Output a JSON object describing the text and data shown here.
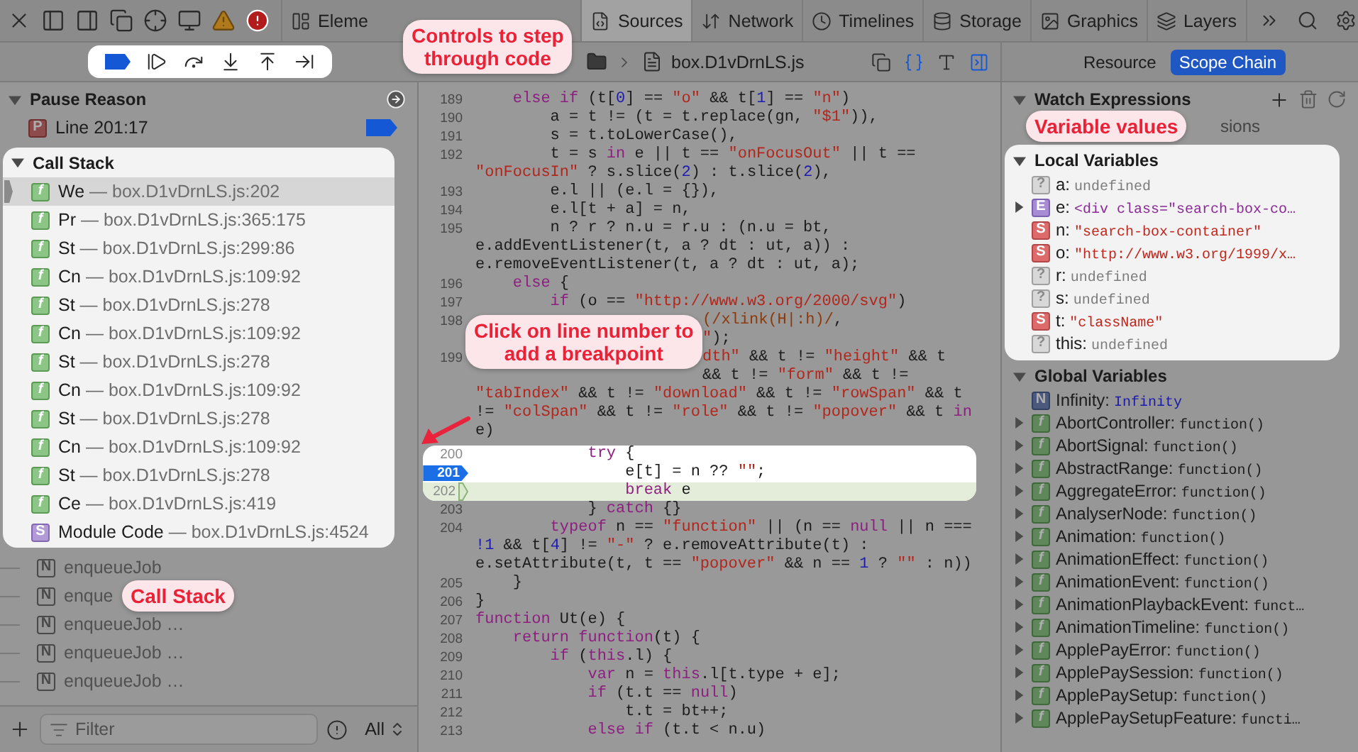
{
  "toolbar": {
    "tabs": [
      {
        "kind": "elements",
        "label": "Eleme",
        "selected": false
      },
      {
        "kind": "sources",
        "label": "Sources",
        "selected": true
      },
      {
        "kind": "network",
        "label": "Network",
        "selected": false
      },
      {
        "kind": "timelines",
        "label": "Timelines",
        "selected": false
      },
      {
        "kind": "storage",
        "label": "Storage",
        "selected": false
      },
      {
        "kind": "graphics",
        "label": "Graphics",
        "selected": false
      },
      {
        "kind": "layers",
        "label": "Layers",
        "selected": false
      }
    ]
  },
  "debugger_bar": {
    "highlighted": true
  },
  "navigation": {
    "file": "box.D1vDrnLS.js"
  },
  "sidebar_switch": [
    {
      "label": "Resource",
      "selected": false
    },
    {
      "label": "Scope Chain",
      "selected": true
    }
  ],
  "pause_reason": {
    "title": "Pause Reason",
    "expanded": true,
    "kind": "pause",
    "badge": "P",
    "text": "Line 201:17"
  },
  "call_stack": {
    "title": "Call Stack",
    "expanded": true,
    "highlighted": true,
    "frames": [
      {
        "kind": "function",
        "badge": "f",
        "name": "We",
        "location": "— box.D1vDrnLS.js:202",
        "selected": true
      },
      {
        "kind": "function",
        "badge": "f",
        "name": "Pr",
        "location": "— box.D1vDrnLS.js:365:175",
        "selected": false
      },
      {
        "kind": "function",
        "badge": "f",
        "name": "St",
        "location": "— box.D1vDrnLS.js:299:86",
        "selected": false
      },
      {
        "kind": "function",
        "badge": "f",
        "name": "Cn",
        "location": "— box.D1vDrnLS.js:109:92",
        "selected": false
      },
      {
        "kind": "function",
        "badge": "f",
        "name": "St",
        "location": "— box.D1vDrnLS.js:278",
        "selected": false
      },
      {
        "kind": "function",
        "badge": "f",
        "name": "Cn",
        "location": "— box.D1vDrnLS.js:109:92",
        "selected": false
      },
      {
        "kind": "function",
        "badge": "f",
        "name": "St",
        "location": "— box.D1vDrnLS.js:278",
        "selected": false
      },
      {
        "kind": "function",
        "badge": "f",
        "name": "Cn",
        "location": "— box.D1vDrnLS.js:109:92",
        "selected": false
      },
      {
        "kind": "function",
        "badge": "f",
        "name": "St",
        "location": "— box.D1vDrnLS.js:278",
        "selected": false
      },
      {
        "kind": "function",
        "badge": "f",
        "name": "Cn",
        "location": "— box.D1vDrnLS.js:109:92",
        "selected": false
      },
      {
        "kind": "function",
        "badge": "f",
        "name": "St",
        "location": "— box.D1vDrnLS.js:278",
        "selected": false
      },
      {
        "kind": "function",
        "badge": "f",
        "name": "Ce",
        "location": "— box.D1vDrnLS.js:419",
        "selected": false
      },
      {
        "kind": "script",
        "badge": "S",
        "name": "Module Code",
        "location": "— box.D1vDrnLS.js:4524",
        "selected": false
      }
    ]
  },
  "async_frames": [
    {
      "kind": "native",
      "badge": "N",
      "name": "enqueueJob"
    },
    {
      "kind": "native",
      "badge": "N",
      "name": "enque"
    },
    {
      "kind": "native",
      "badge": "N",
      "name": "enqueueJob …"
    },
    {
      "kind": "native",
      "badge": "N",
      "name": "enqueueJob …"
    },
    {
      "kind": "native",
      "badge": "N",
      "name": "enqueueJob …"
    }
  ],
  "filter": {
    "placeholder": "Filter",
    "scope": "All"
  },
  "code": {
    "blocks": [
      {
        "highlighted": false,
        "rows": [
          {
            "number": "189",
            "kind": "plain",
            "tokens": [
              {
                "kind": "keyword",
                "text": "    else if"
              },
              {
                "kind": "plain",
                "text": " (t["
              },
              {
                "kind": "number",
                "text": "0"
              },
              {
                "kind": "plain",
                "text": "] == "
              },
              {
                "kind": "string",
                "text": "\"o\""
              },
              {
                "kind": "plain",
                "text": " && t["
              },
              {
                "kind": "number",
                "text": "1"
              },
              {
                "kind": "plain",
                "text": "] == "
              },
              {
                "kind": "string",
                "text": "\"n\""
              },
              {
                "kind": "plain",
                "text": ")"
              }
            ]
          },
          {
            "number": "190",
            "kind": "plain",
            "tokens": [
              {
                "kind": "plain",
                "text": "        a = t != (t = t.replace(gn, "
              },
              {
                "kind": "string",
                "text": "\"$1\""
              },
              {
                "kind": "plain",
                "text": ")),"
              }
            ]
          },
          {
            "number": "191",
            "kind": "plain",
            "tokens": [
              {
                "kind": "plain",
                "text": "        s = t.toLowerCase(),"
              }
            ]
          },
          {
            "number": "192",
            "kind": "plain",
            "tokens": [
              {
                "kind": "plain",
                "text": "        t = s "
              },
              {
                "kind": "keyword",
                "text": "in"
              },
              {
                "kind": "plain",
                "text": " e || t == "
              },
              {
                "kind": "string",
                "text": "\"onFocusOut\""
              },
              {
                "kind": "plain",
                "text": " || t =="
              }
            ]
          },
          {
            "kind": "plain",
            "tokens": [
              {
                "kind": "string",
                "text": "\"onFocusIn\""
              },
              {
                "kind": "plain",
                "text": " ? s.slice("
              },
              {
                "kind": "number",
                "text": "2"
              },
              {
                "kind": "plain",
                "text": ") : t.slice("
              },
              {
                "kind": "number",
                "text": "2"
              },
              {
                "kind": "plain",
                "text": "),"
              }
            ]
          },
          {
            "number": "193",
            "kind": "plain",
            "tokens": [
              {
                "kind": "plain",
                "text": "        e.l || (e.l = {}),"
              }
            ]
          },
          {
            "number": "194",
            "kind": "plain",
            "tokens": [
              {
                "kind": "plain",
                "text": "        e.l[t + a] = n,"
              }
            ]
          },
          {
            "number": "195",
            "kind": "plain",
            "tokens": [
              {
                "kind": "plain",
                "text": "        n ? r ? n.u = r.u : (n.u = bt,"
              }
            ]
          },
          {
            "kind": "plain",
            "tokens": [
              {
                "kind": "plain",
                "text": "e.addEventListener(t, a ? dt : ut, a)) :"
              }
            ]
          },
          {
            "kind": "plain",
            "tokens": [
              {
                "kind": "plain",
                "text": "e.removeEventListener(t, a ? dt : ut, a);"
              }
            ]
          },
          {
            "number": "196",
            "kind": "plain",
            "tokens": [
              {
                "kind": "keyword",
                "text": "    else"
              },
              {
                "kind": "plain",
                "text": " {"
              }
            ]
          },
          {
            "number": "197",
            "kind": "plain",
            "tokens": [
              {
                "kind": "keyword",
                "text": "        if"
              },
              {
                "kind": "plain",
                "text": " (o == "
              },
              {
                "kind": "string",
                "text": "\"http://www.w3.org/2000/svg\""
              },
              {
                "kind": "plain",
                "text": ")"
              }
            ]
          },
          {
            "number": "198",
            "kind": "covered",
            "tokens": [
              {
                "kind": "regex",
                "text": "(/xlink(H|:h)/"
              },
              {
                "kind": "plain",
                "text": ","
              }
            ]
          },
          {
            "kind": "covered",
            "tokens": [
              {
                "kind": "string",
                "text": "\""
              },
              {
                "kind": "plain",
                "text": ");"
              }
            ]
          },
          {
            "number": "199",
            "kind": "covered",
            "tokens": [
              {
                "kind": "string",
                "text": "dth\""
              },
              {
                "kind": "plain",
                "text": " && t != "
              },
              {
                "kind": "string",
                "text": "\"height\""
              },
              {
                "kind": "plain",
                "text": " && t"
              }
            ]
          },
          {
            "kind": "covered",
            "tokens": [
              {
                "kind": "plain",
                "text": "&& t != "
              },
              {
                "kind": "string",
                "text": "\"form\""
              },
              {
                "kind": "plain",
                "text": " && t !="
              }
            ]
          },
          {
            "kind": "plain",
            "tokens": [
              {
                "kind": "string",
                "text": "\"tabIndex\""
              },
              {
                "kind": "plain",
                "text": " && t != "
              },
              {
                "kind": "string",
                "text": "\"download\""
              },
              {
                "kind": "plain",
                "text": " && t != "
              },
              {
                "kind": "string",
                "text": "\"rowSpan\""
              },
              {
                "kind": "plain",
                "text": " && t"
              }
            ]
          },
          {
            "kind": "plain",
            "tokens": [
              {
                "kind": "plain",
                "text": "!= "
              },
              {
                "kind": "string",
                "text": "\"colSpan\""
              },
              {
                "kind": "plain",
                "text": " && t != "
              },
              {
                "kind": "string",
                "text": "\"role\""
              },
              {
                "kind": "plain",
                "text": " && t != "
              },
              {
                "kind": "string",
                "text": "\"popover\""
              },
              {
                "kind": "plain",
                "text": " && t "
              },
              {
                "kind": "keyword",
                "text": "in"
              }
            ]
          },
          {
            "kind": "plain",
            "tokens": [
              {
                "kind": "plain",
                "text": "e)"
              }
            ]
          }
        ]
      },
      {
        "highlighted": true,
        "rows": [
          {
            "number": "200",
            "kind": "plain",
            "tokens": [
              {
                "kind": "keyword",
                "text": "            try"
              },
              {
                "kind": "plain",
                "text": " {"
              }
            ]
          },
          {
            "number": "201",
            "kind": "breakpoint",
            "tokens": [
              {
                "kind": "plain",
                "text": "                e[t] = n ?? "
              },
              {
                "kind": "string",
                "text": "\"\""
              },
              {
                "kind": "plain",
                "text": ";"
              }
            ]
          },
          {
            "number": "202",
            "kind": "current",
            "tokens": [
              {
                "kind": "keyword",
                "text": "                break"
              },
              {
                "kind": "plain",
                "text": " e"
              }
            ]
          }
        ]
      },
      {
        "highlighted": false,
        "rows": [
          {
            "number": "203",
            "kind": "plain",
            "tokens": [
              {
                "kind": "plain",
                "text": "            } "
              },
              {
                "kind": "keyword",
                "text": "catch"
              },
              {
                "kind": "plain",
                "text": " {}"
              }
            ]
          },
          {
            "number": "204",
            "kind": "plain",
            "tokens": [
              {
                "kind": "keyword",
                "text": "        typeof"
              },
              {
                "kind": "plain",
                "text": " n == "
              },
              {
                "kind": "string",
                "text": "\"function\""
              },
              {
                "kind": "plain",
                "text": " || (n == "
              },
              {
                "kind": "keyword",
                "text": "null"
              },
              {
                "kind": "plain",
                "text": " || n ==="
              }
            ]
          },
          {
            "kind": "plain",
            "tokens": [
              {
                "kind": "number",
                "text": "!1"
              },
              {
                "kind": "plain",
                "text": " && t["
              },
              {
                "kind": "number",
                "text": "4"
              },
              {
                "kind": "plain",
                "text": "] != "
              },
              {
                "kind": "string",
                "text": "\"-\""
              },
              {
                "kind": "plain",
                "text": " ? e.removeAttribute(t) :"
              }
            ]
          },
          {
            "kind": "plain",
            "tokens": [
              {
                "kind": "plain",
                "text": "e.setAttribute(t, t == "
              },
              {
                "kind": "string",
                "text": "\"popover\""
              },
              {
                "kind": "plain",
                "text": " && n == "
              },
              {
                "kind": "number",
                "text": "1"
              },
              {
                "kind": "plain",
                "text": " ? "
              },
              {
                "kind": "string",
                "text": "\"\""
              },
              {
                "kind": "plain",
                "text": " : n))"
              }
            ]
          },
          {
            "number": "205",
            "kind": "plain",
            "tokens": [
              {
                "kind": "plain",
                "text": "    }"
              }
            ]
          },
          {
            "number": "206",
            "kind": "plain",
            "tokens": [
              {
                "kind": "plain",
                "text": "}"
              }
            ]
          },
          {
            "number": "207",
            "kind": "plain",
            "tokens": [
              {
                "kind": "keyword",
                "text": "function"
              },
              {
                "kind": "plain",
                "text": " Ut(e) {"
              }
            ]
          },
          {
            "number": "208",
            "kind": "plain",
            "tokens": [
              {
                "kind": "keyword",
                "text": "    return function"
              },
              {
                "kind": "plain",
                "text": "(t) {"
              }
            ]
          },
          {
            "number": "209",
            "kind": "plain",
            "tokens": [
              {
                "kind": "keyword",
                "text": "        if"
              },
              {
                "kind": "plain",
                "text": " ("
              },
              {
                "kind": "keyword",
                "text": "this"
              },
              {
                "kind": "plain",
                "text": ".l) {"
              }
            ]
          },
          {
            "number": "210",
            "kind": "plain",
            "tokens": [
              {
                "kind": "keyword",
                "text": "            var"
              },
              {
                "kind": "plain",
                "text": " n = "
              },
              {
                "kind": "keyword",
                "text": "this"
              },
              {
                "kind": "plain",
                "text": ".l[t.type + e];"
              }
            ]
          },
          {
            "number": "211",
            "kind": "plain",
            "tokens": [
              {
                "kind": "keyword",
                "text": "            if"
              },
              {
                "kind": "plain",
                "text": " (t.t == "
              },
              {
                "kind": "keyword",
                "text": "null"
              },
              {
                "kind": "plain",
                "text": ")"
              }
            ]
          },
          {
            "number": "212",
            "kind": "plain",
            "tokens": [
              {
                "kind": "plain",
                "text": "                t.t = bt++;"
              }
            ]
          },
          {
            "number": "213",
            "kind": "plain",
            "tokens": [
              {
                "kind": "keyword",
                "text": "            else if"
              },
              {
                "kind": "plain",
                "text": " (t.t < n.u)"
              }
            ]
          }
        ]
      }
    ]
  },
  "watch": {
    "title": "Watch Expressions",
    "expanded": true,
    "subtitle": "sions"
  },
  "local_variables": {
    "title": "Local Variables",
    "expanded": true,
    "highlighted": true,
    "items": [
      {
        "kind": "undefined",
        "badge": "?",
        "name": "a:",
        "value": "undefined"
      },
      {
        "kind": "element",
        "badge": "E",
        "name": "e:",
        "value": "<div class=\"search-box-co…",
        "expanded": false
      },
      {
        "kind": "string",
        "badge": "S",
        "name": "n:",
        "value": "\"search-box-container\""
      },
      {
        "kind": "string",
        "badge": "S",
        "name": "o:",
        "value": "\"http://www.w3.org/1999/x…"
      },
      {
        "kind": "undefined",
        "badge": "?",
        "name": "r:",
        "value": "undefined"
      },
      {
        "kind": "undefined",
        "badge": "?",
        "name": "s:",
        "value": "undefined"
      },
      {
        "kind": "string",
        "badge": "S",
        "name": "t:",
        "value": "\"className\""
      },
      {
        "kind": "undefined",
        "badge": "?",
        "name": "this:",
        "value": "undefined"
      }
    ]
  },
  "global_variables": {
    "title": "Global Variables",
    "expanded": true,
    "highlighted": false,
    "items": [
      {
        "kind": "number",
        "badge": "N",
        "name": "Infinity:",
        "value": "Infinity"
      },
      {
        "kind": "function",
        "badge": "f",
        "name": "AbortController:",
        "value": "function()",
        "expanded": false
      },
      {
        "kind": "function",
        "badge": "f",
        "name": "AbortSignal:",
        "value": "function()",
        "expanded": false
      },
      {
        "kind": "function",
        "badge": "f",
        "name": "AbstractRange:",
        "value": "function()",
        "expanded": false
      },
      {
        "kind": "function",
        "badge": "f",
        "name": "AggregateError:",
        "value": "function()",
        "expanded": false
      },
      {
        "kind": "function",
        "badge": "f",
        "name": "AnalyserNode:",
        "value": "function()",
        "expanded": false
      },
      {
        "kind": "function",
        "badge": "f",
        "name": "Animation:",
        "value": "function()",
        "expanded": false
      },
      {
        "kind": "function",
        "badge": "f",
        "name": "AnimationEffect:",
        "value": "function()",
        "expanded": false
      },
      {
        "kind": "function",
        "badge": "f",
        "name": "AnimationEvent:",
        "value": "function()",
        "expanded": false
      },
      {
        "kind": "function",
        "badge": "f",
        "name": "AnimationPlaybackEvent:",
        "value": "funct…",
        "expanded": false
      },
      {
        "kind": "function",
        "badge": "f",
        "name": "AnimationTimeline:",
        "value": "function()",
        "expanded": false
      },
      {
        "kind": "function",
        "badge": "f",
        "name": "ApplePayError:",
        "value": "function()",
        "expanded": false
      },
      {
        "kind": "function",
        "badge": "f",
        "name": "ApplePaySession:",
        "value": "function()",
        "expanded": false
      },
      {
        "kind": "function",
        "badge": "f",
        "name": "ApplePaySetup:",
        "value": "function()",
        "expanded": false
      },
      {
        "kind": "function",
        "badge": "f",
        "name": "ApplePaySetupFeature:",
        "value": "functi…",
        "expanded": false
      }
    ]
  },
  "annotations": [
    {
      "text": "Controls to step through code",
      "arrow": false
    },
    {
      "text": "Variable values",
      "arrow": false
    },
    {
      "text": "Click on line number to add a breakpoint",
      "arrow": true
    },
    {
      "text": "Call Stack",
      "arrow": false
    }
  ]
}
